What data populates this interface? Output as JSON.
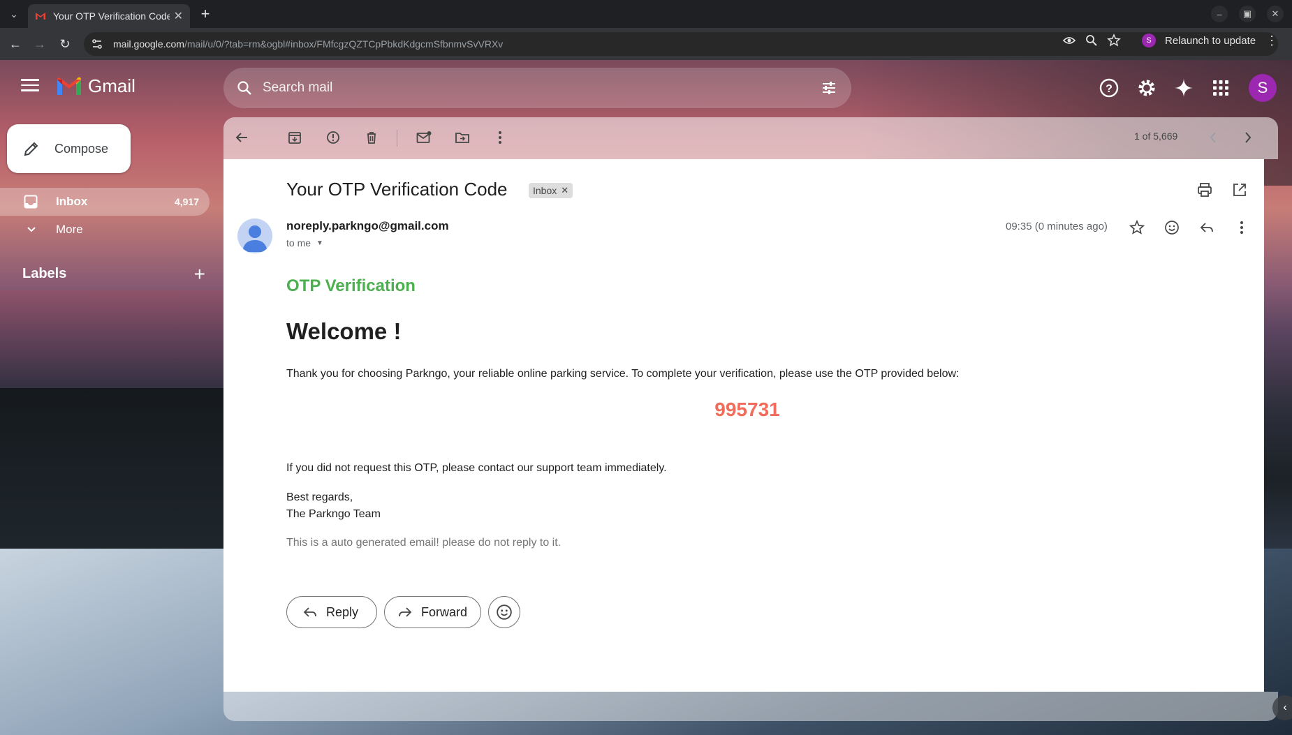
{
  "browser": {
    "tab_title": "Your OTP Verification Code",
    "url_domain": "mail.google.com",
    "url_path": "/mail/u/0/?tab=rm&ogbl#inbox/FMfcgzQZTCpPbkdKdgcmSfbnmvSvVRXv",
    "profile_initial": "S",
    "relaunch_label": "Relaunch to update"
  },
  "gmail": {
    "logo_text": "Gmail",
    "search_placeholder": "Search mail",
    "account_initial": "S",
    "compose_label": "Compose",
    "nav": {
      "inbox_label": "Inbox",
      "inbox_count": "4,917",
      "more_label": "More",
      "labels_heading": "Labels"
    },
    "pager": "1 of 5,669"
  },
  "email": {
    "subject": "Your OTP Verification Code",
    "label_chip": "Inbox",
    "sender": "noreply.parkngo@gmail.com",
    "recipient_line": "to me",
    "time": "09:35 (0 minutes ago)",
    "body": {
      "heading": "OTP Verification",
      "welcome": "Welcome !",
      "intro": "Thank you for choosing Parkngo, your reliable online parking service. To complete your verification, please use the OTP provided below:",
      "otp_code": "995731",
      "warning": "If you did not request this OTP, please contact our support team immediately.",
      "regards": "Best regards,",
      "team": "The Parkngo Team",
      "auto_note": "This is a auto generated email! please do not reply to it."
    },
    "reply_label": "Reply",
    "forward_label": "Forward"
  },
  "colors": {
    "otp_heading": "#4caf50",
    "otp_code": "#f26b5b",
    "account_avatar": "#9c27b0"
  }
}
